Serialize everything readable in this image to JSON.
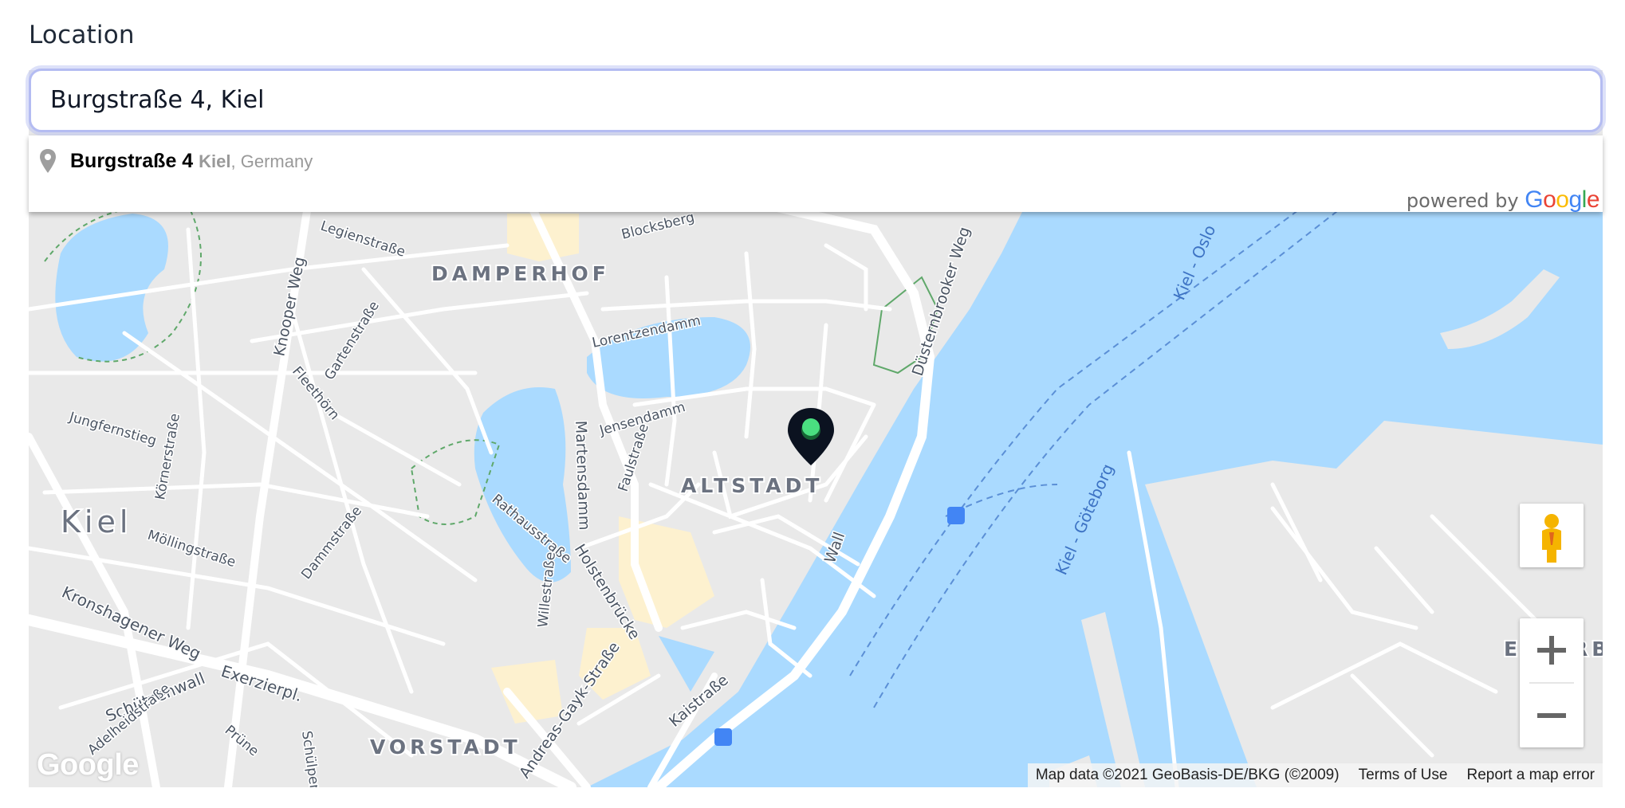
{
  "field": {
    "label": "Location",
    "value": "Burgstraße 4, Kiel"
  },
  "autocomplete": {
    "suggestions": [
      {
        "main": "Burgstraße 4",
        "city": "Kiel",
        "rest": ", Germany"
      }
    ],
    "powered_by": "powered by",
    "powered_logo": "Google"
  },
  "map": {
    "district_labels": [
      "DAMPERHOF",
      "ALTSTADT",
      "VORSTADT",
      "Kiel",
      "ELLERBEK"
    ],
    "street_labels": [
      "Legienstraße",
      "Blocksberg",
      "Knooper Weg",
      "Gartenstraße",
      "Fleethörn",
      "Lorentzendamm",
      "Jensendamm",
      "Jungfernstieg",
      "Körnerstraße",
      "Martensdamm",
      "Faulstraße",
      "Rathausstraße",
      "Dammstraße",
      "Möllingstraße",
      "Kronshagener Weg",
      "Exerzierpl.",
      "Schützenwall",
      "Adelheidstraße",
      "Holstenbrücke",
      "Willestraße",
      "Andreas-Gayk-Straße",
      "Kaistraße",
      "Wall",
      "Düsternbrooker Weg",
      "Prüne",
      "Schülperbaum"
    ],
    "water_labels": [
      "Kiel - Oslo",
      "Kiel - Göteborg"
    ],
    "google_logo": "Google",
    "attribution": [
      "Map data ©2021 GeoBasis-DE/BKG (©2009)",
      "Terms of Use",
      "Report a map error"
    ],
    "controls": {
      "pegman_icon": "pegman-icon",
      "zoom_in_icon": "plus-icon",
      "zoom_out_icon": "minus-icon"
    },
    "marker": {
      "icon": "map-pin-icon",
      "color": "#0b1220",
      "dot_color": "#4ade80"
    },
    "colors": {
      "water": "#aadaff",
      "land": "#e9e9e9",
      "road": "#ffffff",
      "park_line": "#5fa86a",
      "commercial": "#fdf1cf"
    }
  }
}
